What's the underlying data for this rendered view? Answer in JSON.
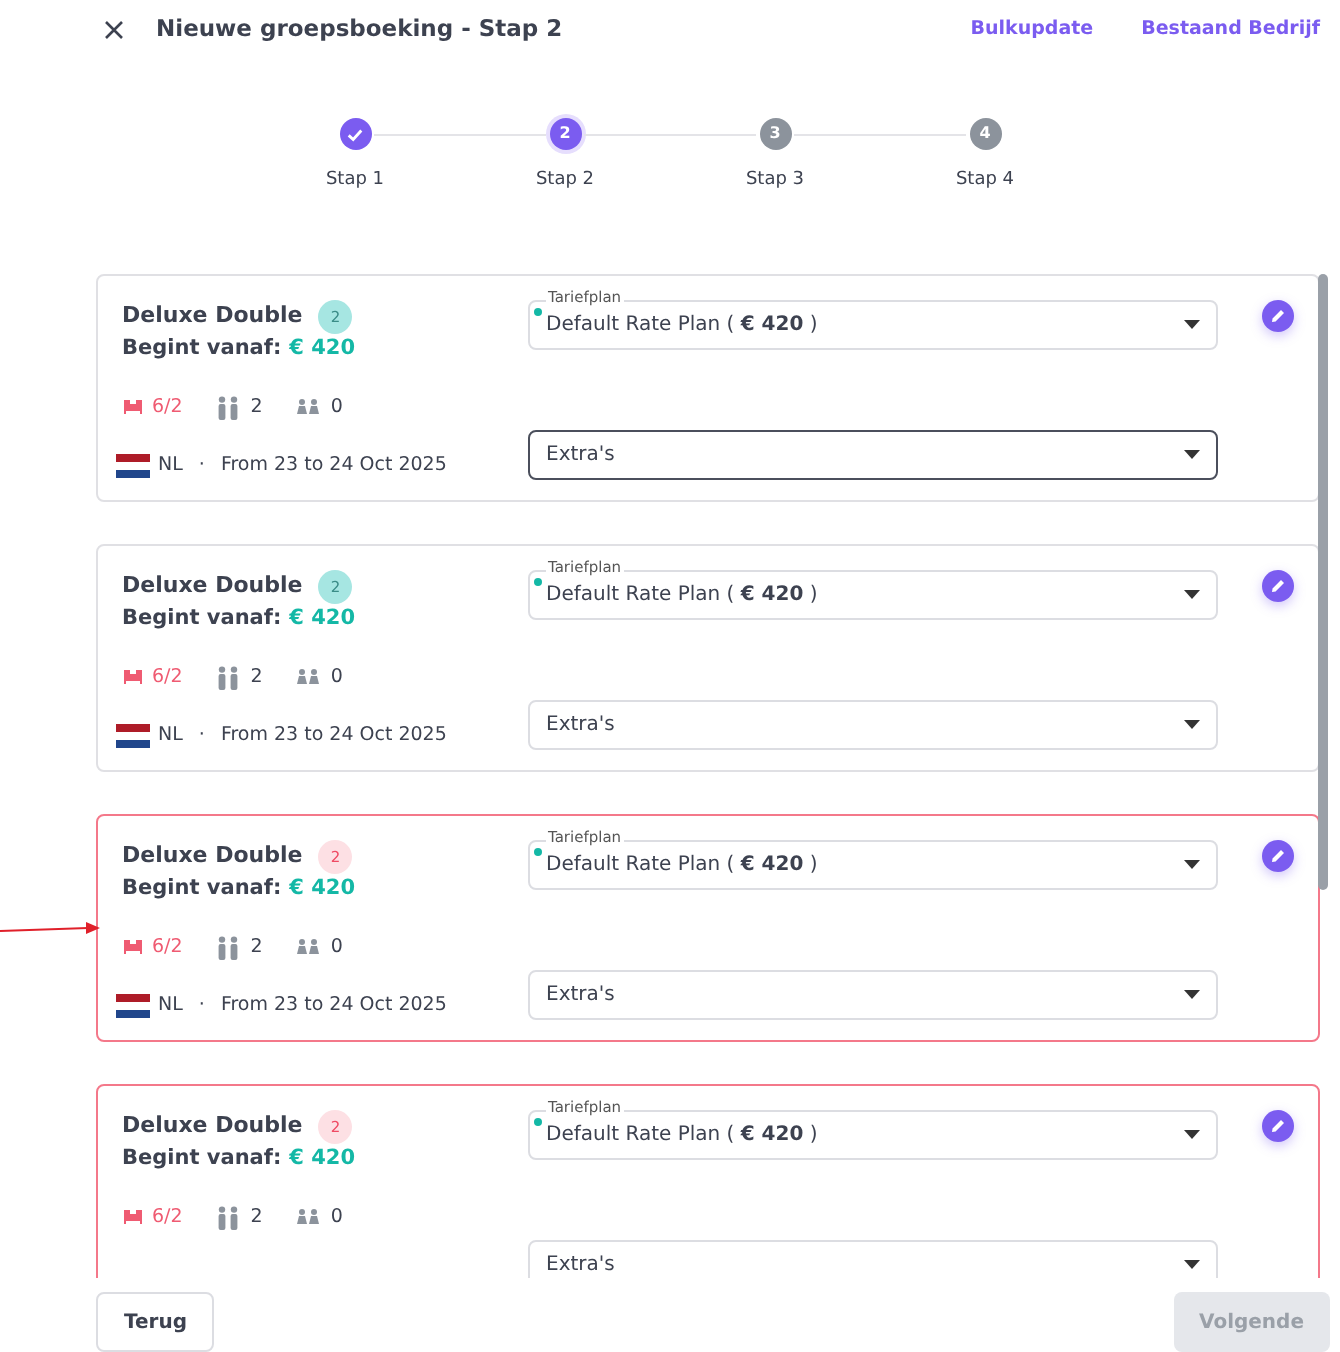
{
  "header": {
    "title": "Nieuwe groepsboeking - Stap 2",
    "links": [
      "Bulkupdate",
      "Bestaand Bedrijf"
    ]
  },
  "steps": [
    {
      "label": "Stap 1",
      "completed": true,
      "selected": false
    },
    {
      "label": "Stap 2",
      "number": "2",
      "completed": false,
      "selected": true
    },
    {
      "label": "Stap 3",
      "number": "3",
      "completed": false,
      "selected": false
    },
    {
      "label": "Stap 4",
      "number": "4",
      "completed": false,
      "selected": false
    }
  ],
  "rooms": [
    {
      "name": "Deluxe Double",
      "count": "2",
      "invalid": false,
      "from_label": "Begint vanaf:",
      "price": "€ 420",
      "beds": "6/2",
      "adults": "2",
      "children": "0",
      "country": "NL",
      "separator": "·",
      "dates": "From 23 to 24 Oct 2025",
      "rate_label": "Tariefplan",
      "rate_plan": "Default Rate Plan ( **€ 420** )",
      "extras": "Extra's",
      "extras_focused": true
    },
    {
      "name": "Deluxe Double",
      "count": "2",
      "invalid": false,
      "from_label": "Begint vanaf:",
      "price": "€ 420",
      "beds": "6/2",
      "adults": "2",
      "children": "0",
      "country": "NL",
      "separator": "·",
      "dates": "From 23 to 24 Oct 2025",
      "rate_label": "Tariefplan",
      "rate_plan": "Default Rate Plan ( **€ 420** )",
      "extras": "Extra's",
      "extras_focused": false
    },
    {
      "name": "Deluxe Double",
      "count": "2",
      "invalid": true,
      "from_label": "Begint vanaf:",
      "price": "€ 420",
      "beds": "6/2",
      "adults": "2",
      "children": "0",
      "country": "NL",
      "separator": "·",
      "dates": "From 23 to 24 Oct 2025",
      "rate_label": "Tariefplan",
      "rate_plan": "Default Rate Plan ( **€ 420** )",
      "extras": "Extra's",
      "extras_focused": false
    },
    {
      "name": "Deluxe Double",
      "count": "2",
      "invalid": true,
      "from_label": "Begint vanaf:",
      "price": "€ 420",
      "beds": "6/2",
      "adults": "2",
      "children": "0",
      "rate_label": "Tariefplan",
      "rate_plan": "Default Rate Plan ( **€ 420** )",
      "extras": "Extra's",
      "extras_focused": false
    }
  ],
  "footer": {
    "back": "Terug",
    "next": "Volgende",
    "next_disabled": true
  }
}
